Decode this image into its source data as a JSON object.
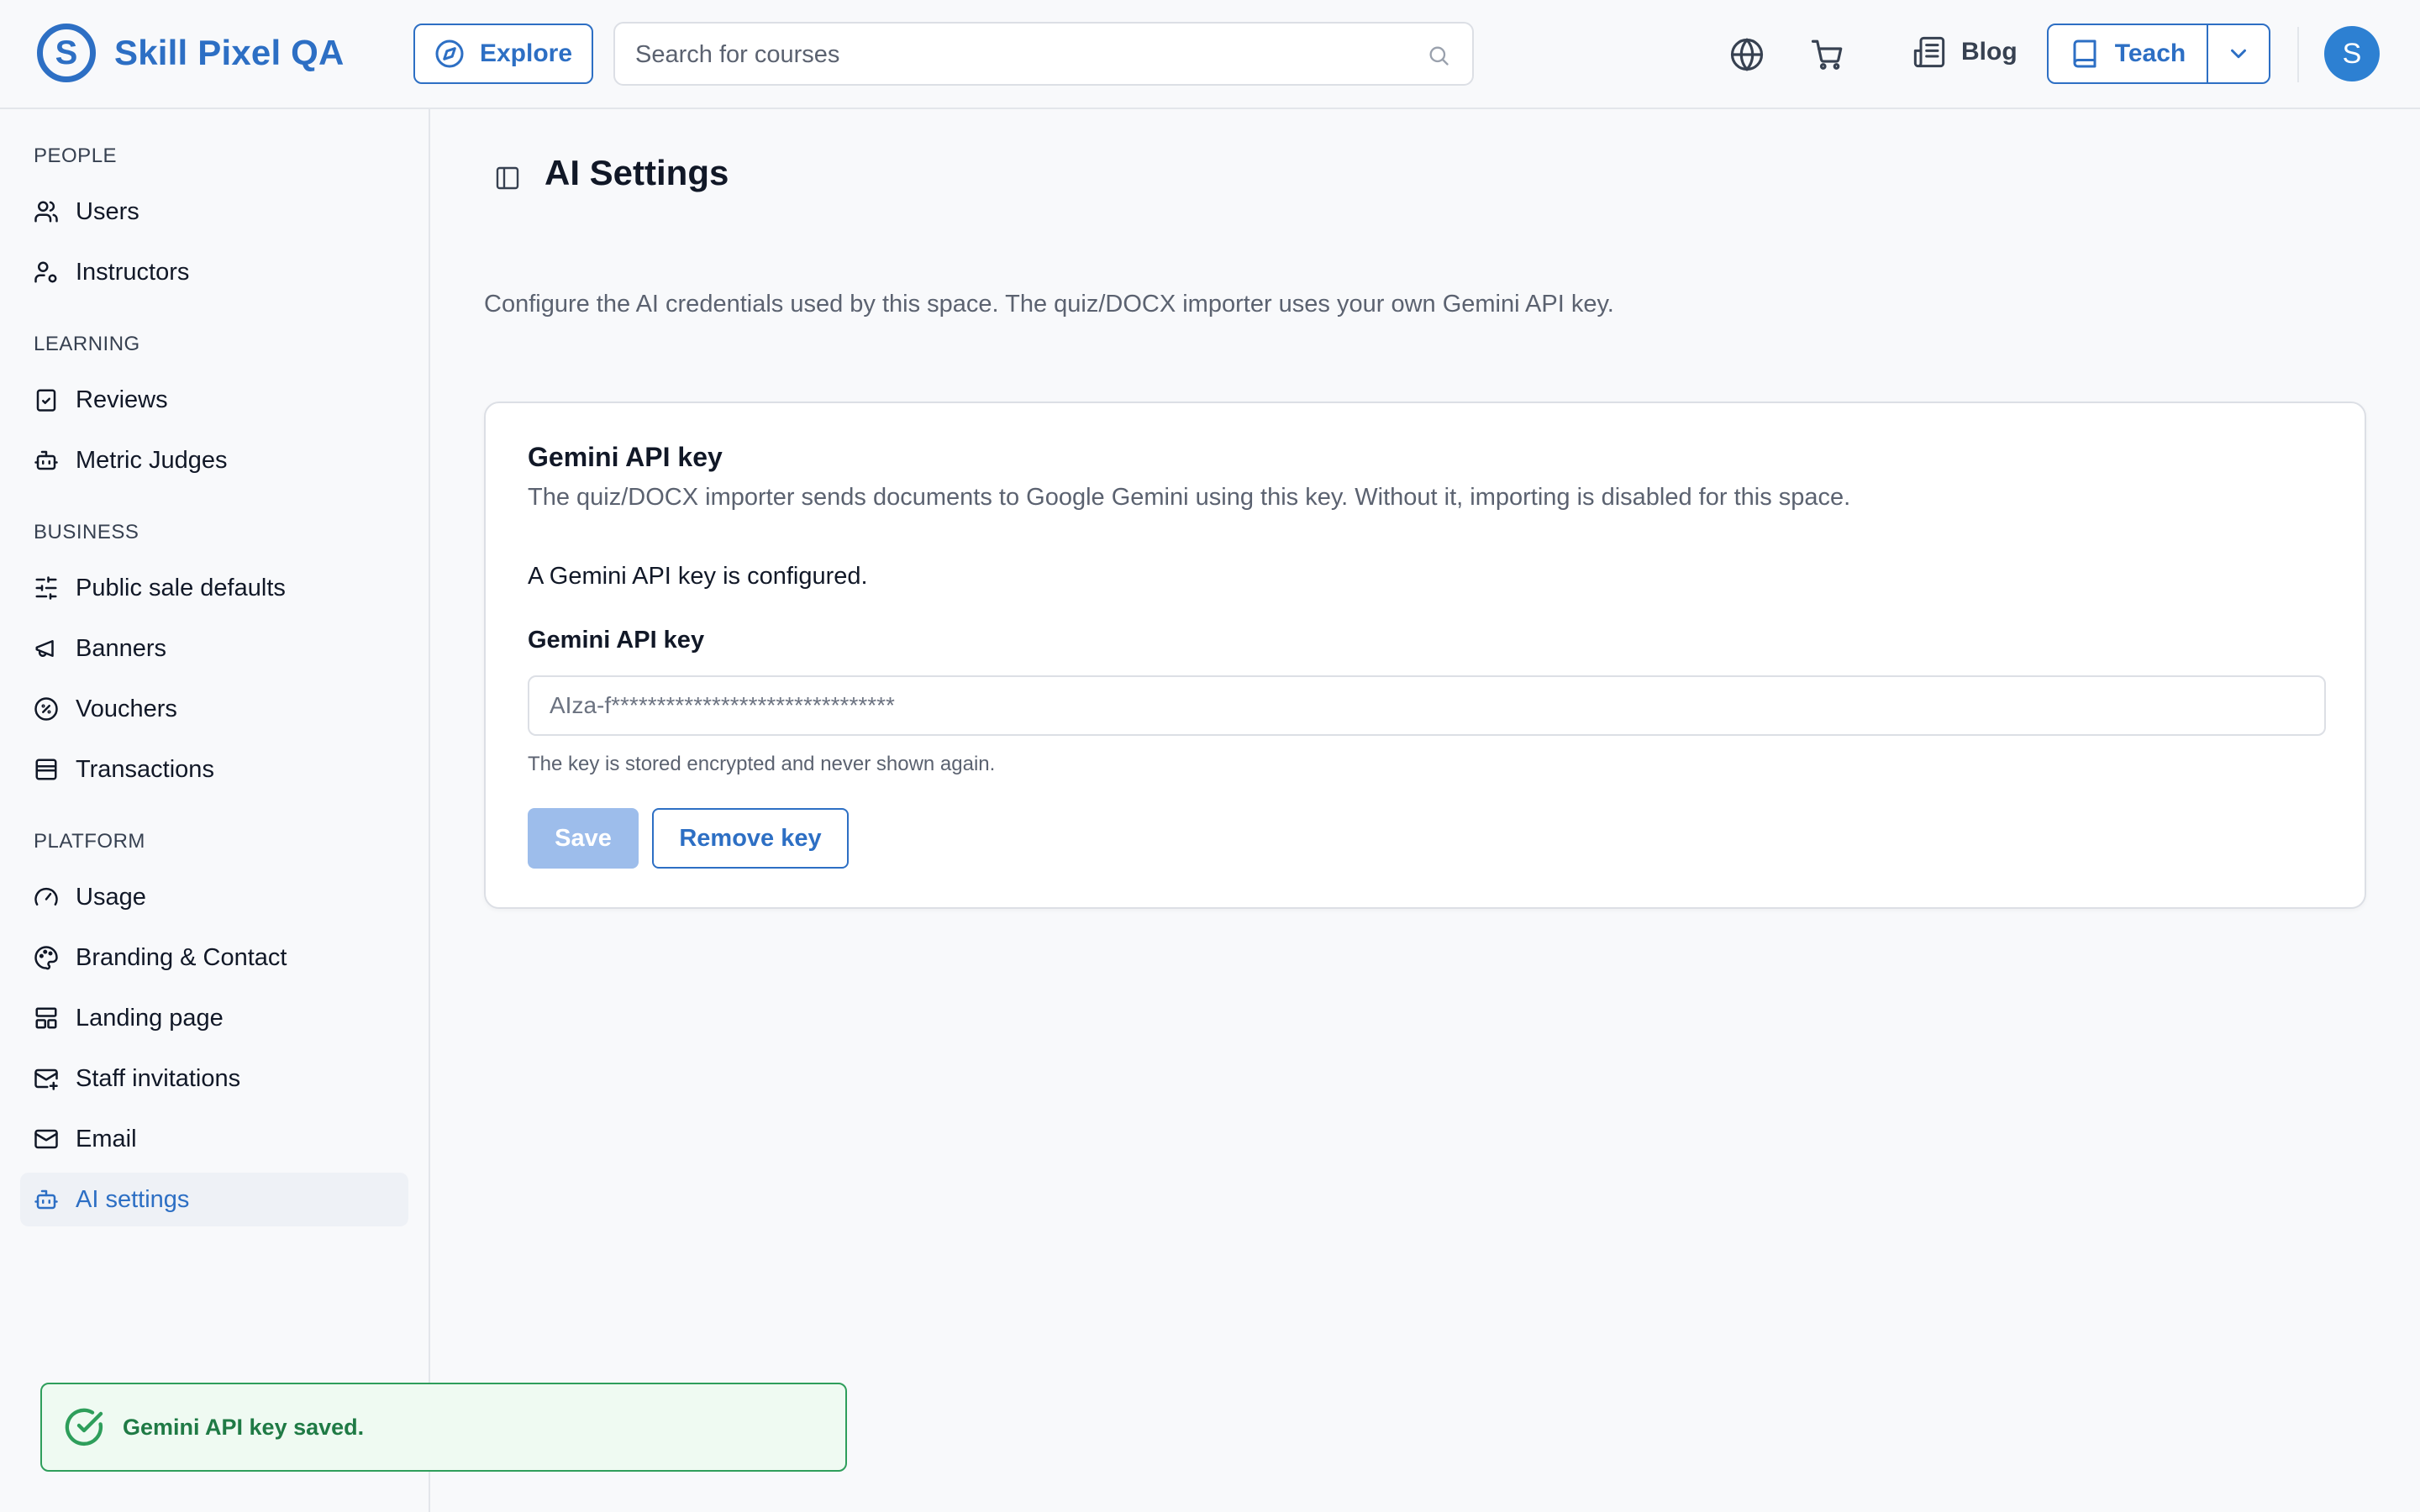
{
  "app": {
    "name": "Skill Pixel QA",
    "logo_letter": "S",
    "brand_color": "#2d6fc4"
  },
  "header": {
    "explore_label": "Explore",
    "search_placeholder": "Search for courses",
    "blog_label": "Blog",
    "teach_label": "Teach",
    "avatar_initial": "S",
    "icons": [
      "compass-icon",
      "search-icon",
      "globe-icon",
      "cart-icon",
      "newspaper-icon",
      "book-icon",
      "chevron-down-icon"
    ]
  },
  "sidebar": {
    "sections": [
      {
        "title": "PEOPLE",
        "items": [
          {
            "label": "Users",
            "icon": "users-icon"
          },
          {
            "label": "Instructors",
            "icon": "user-cog-icon"
          }
        ]
      },
      {
        "title": "LEARNING",
        "items": [
          {
            "label": "Reviews",
            "icon": "clipboard-check-icon"
          },
          {
            "label": "Metric Judges",
            "icon": "bot-icon"
          }
        ]
      },
      {
        "title": "BUSINESS",
        "items": [
          {
            "label": "Public sale defaults",
            "icon": "sliders-icon"
          },
          {
            "label": "Banners",
            "icon": "megaphone-icon"
          },
          {
            "label": "Vouchers",
            "icon": "badge-percent-icon"
          },
          {
            "label": "Transactions",
            "icon": "receipt-icon"
          }
        ]
      },
      {
        "title": "PLATFORM",
        "items": [
          {
            "label": "Usage",
            "icon": "gauge-icon"
          },
          {
            "label": "Branding & Contact",
            "icon": "palette-icon"
          },
          {
            "label": "Landing page",
            "icon": "layout-icon"
          },
          {
            "label": "Staff invitations",
            "icon": "mail-plus-icon"
          },
          {
            "label": "Email",
            "icon": "mail-icon"
          },
          {
            "label": "AI settings",
            "icon": "bot-icon",
            "active": true
          }
        ]
      }
    ]
  },
  "main": {
    "title": "AI Settings",
    "description": "Configure the AI credentials used by this space. The quiz/DOCX importer uses your own Gemini API key.",
    "card": {
      "title": "Gemini API key",
      "description": "The quiz/DOCX importer sends documents to Google Gemini using this key. Without it, importing is disabled for this space.",
      "status": "A Gemini API key is configured.",
      "field_label": "Gemini API key",
      "field_placeholder": "AIza-f*******************************",
      "hint": "The key is stored encrypted and never shown again.",
      "save_label": "Save",
      "remove_label": "Remove key"
    }
  },
  "toast": {
    "message": "Gemini API key saved.",
    "status_color": "#2e9e5b"
  }
}
